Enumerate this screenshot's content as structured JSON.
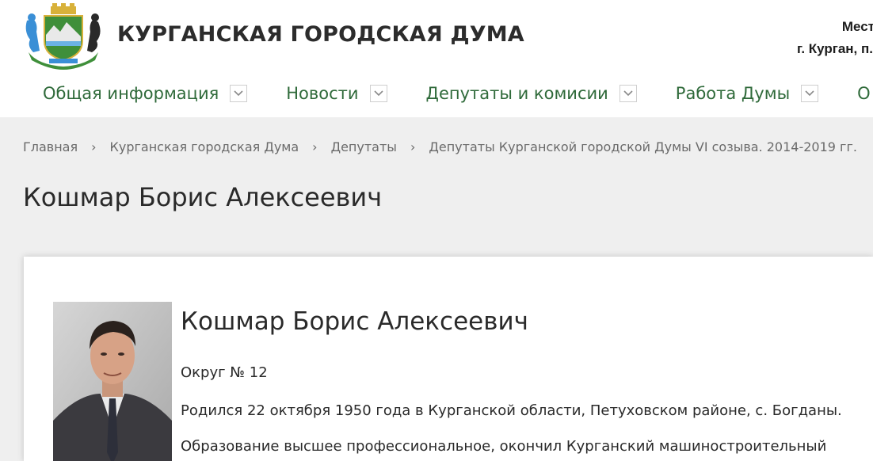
{
  "header": {
    "site_title": "КУРГАНСКАЯ ГОРОДСКАЯ ДУМА",
    "top_right_line1": "Мест",
    "top_right_line2": "г. Курган, п.",
    "brand_color": "#2f6a3a"
  },
  "nav": {
    "items": [
      {
        "label": "Общая информация",
        "icon": "chevron-down-icon"
      },
      {
        "label": "Новости",
        "icon": "chevron-down-icon"
      },
      {
        "label": "Депутаты и комисии",
        "icon": "chevron-down-icon"
      },
      {
        "label": "Работа Думы",
        "icon": "chevron-down-icon"
      },
      {
        "label": "О",
        "icon": ""
      }
    ]
  },
  "breadcrumb": {
    "items": [
      "Главная",
      "Курганская городская Дума",
      "Депутаты",
      "Депутаты Курганской городской Думы VI созыва. 2014-2019 гг."
    ],
    "separator": "›"
  },
  "page": {
    "title": "Кошмар Борис Алексеевич"
  },
  "deputy": {
    "name": "Кошмар Борис Алексеевич",
    "district": "Округ № 12",
    "born": "Родился 22 октября 1950 года в Курганской области, Петуховском районе, с. Богданы.",
    "education": "Образование высшее профессиональное, окончил Курганский машиностроительный"
  }
}
